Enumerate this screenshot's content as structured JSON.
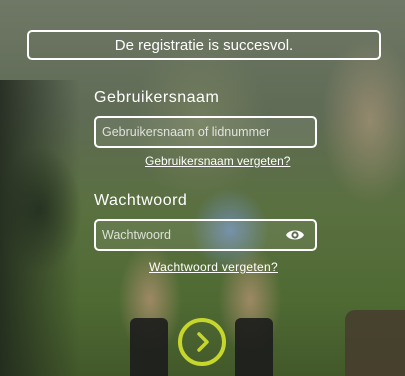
{
  "banner": {
    "message": "De registratie is succesvol."
  },
  "username": {
    "label": "Gebruikersnaam",
    "placeholder": "Gebruikersnaam of lidnummer",
    "value": "",
    "forgot_link": "Gebruikersnaam vergeten?"
  },
  "password": {
    "label": "Wachtwoord",
    "placeholder": "Wachtwoord",
    "value": "",
    "forgot_link": "Wachtwoord vergeten?",
    "toggle_icon": "eye-icon"
  },
  "submit": {
    "icon": "chevron-right-icon",
    "accent_color": "#c7d62a"
  }
}
